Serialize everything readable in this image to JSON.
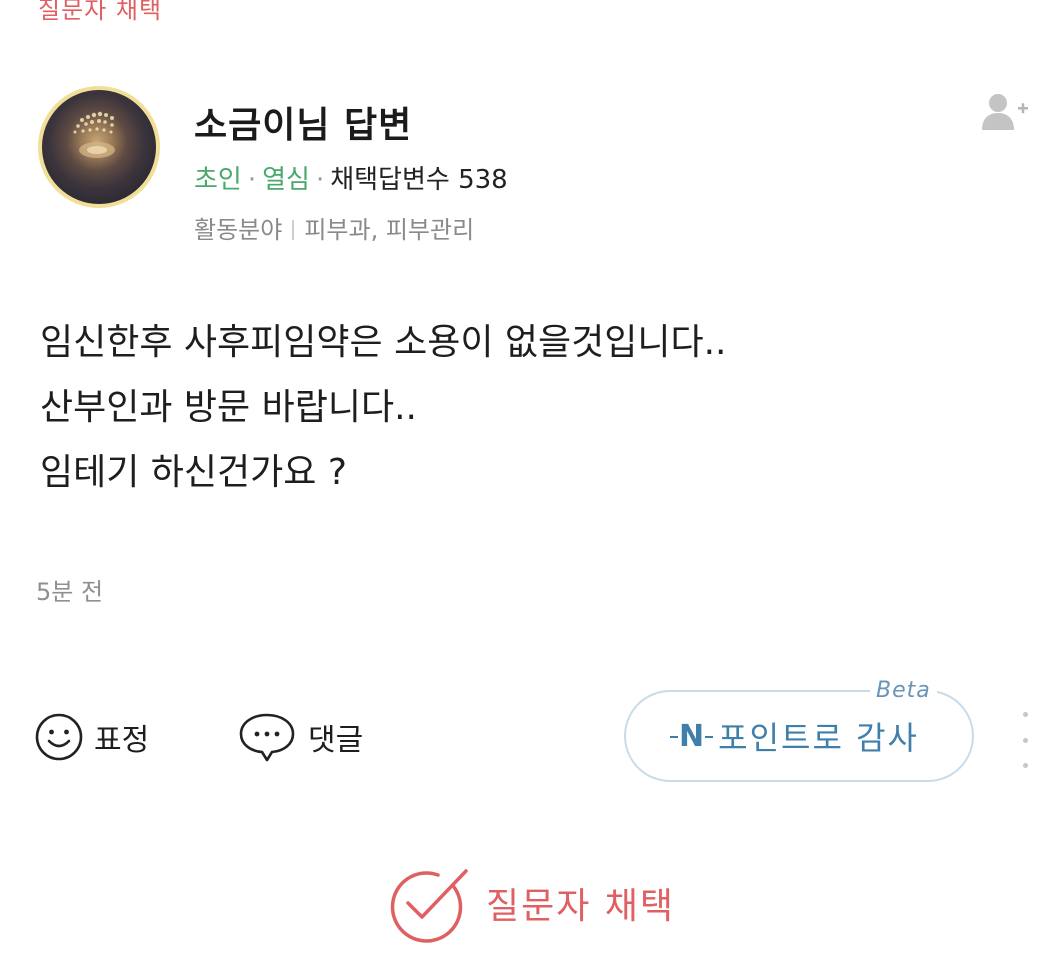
{
  "top_tag": "질문자 채택",
  "answer": {
    "author_name": "소금이님 답변",
    "grade": "초인",
    "activity": "열심",
    "selected_count_label": "채택답변수 538",
    "field_label": "활동분야",
    "field_value": "피부과, 피부관리",
    "body_lines": [
      "임신한후 사후피임약은 소용이 없을것입니다..",
      "산부인과 방문 바랍니다..",
      "임테기 하신건가요 ?"
    ],
    "time_ago": "5분 전"
  },
  "actions": {
    "emoji_label": "표정",
    "comment_label": "댓글",
    "thanks_label": "포인트로 감사",
    "thanks_icon": "N",
    "beta_label": "Beta"
  },
  "select_label": "질문자 채택",
  "colors": {
    "accent_red": "#e05f62",
    "grade_green": "#4aa86a",
    "thanks_blue": "#3f7fa9",
    "avatar_ring": "#f2df97"
  },
  "icons": {
    "follow": "add-user-icon",
    "emoji": "smile-icon",
    "comment": "speech-bubble-icon",
    "more": "vertical-dots-icon",
    "select": "check-circle-icon"
  }
}
